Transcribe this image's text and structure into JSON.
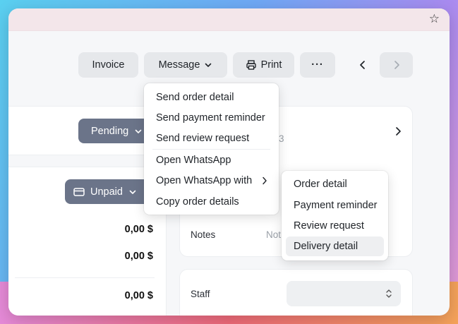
{
  "toolbar": {
    "invoice_label": "Invoice",
    "message_label": "Message",
    "print_label": "Print",
    "more_label": "···"
  },
  "status": {
    "order_status": "Pending",
    "payment_status": "Unpaid"
  },
  "amounts": [
    "0,00 $",
    "0,00 $",
    "0,00 $"
  ],
  "message_menu": {
    "items": [
      "Send order detail",
      "Send payment reminder",
      "Send review request",
      "Open WhatsApp",
      "Open WhatsApp with",
      "Copy order details"
    ]
  },
  "whatsapp_submenu": {
    "items": [
      "Order detail",
      "Payment reminder",
      "Review request",
      "Delivery detail"
    ],
    "active_index": 3
  },
  "details": {
    "notes_label": "Notes",
    "notes_placeholder": "Not",
    "obscured_fragment": "3",
    "staff_label": "Staff"
  },
  "colors": {
    "pill_bg": "#6b7489",
    "button_bg": "#e6e8eb",
    "window_bg": "#f6f7f9"
  }
}
